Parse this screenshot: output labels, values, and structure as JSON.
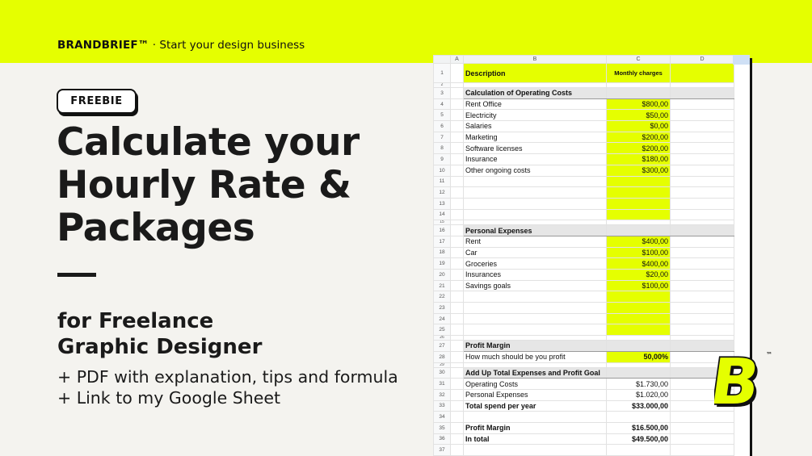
{
  "header": {
    "brand": "BRANDBRIEF™",
    "tagline": "· Start your design business"
  },
  "badge": "FREEBIE",
  "headline": [
    "Calculate your",
    "Hourly Rate &",
    "Packages"
  ],
  "subtitle": [
    "for Freelance",
    "Graphic Designer"
  ],
  "extras": [
    "+ PDF with explanation, tips and formula",
    "+ Link to my Google Sheet"
  ],
  "logo": {
    "letter": "B",
    "mark": "™"
  },
  "colors": {
    "accent": "#e5ff00",
    "ink": "#111111",
    "background": "#f4f3ef"
  },
  "sheet": {
    "columns": [
      "A",
      "B",
      "C",
      "D"
    ],
    "header_row": {
      "num": "1",
      "description": "Description",
      "monthly": "Monthly charges"
    },
    "operating": {
      "title_num": "3",
      "title": "Calculation of Operating Costs",
      "rows": [
        {
          "num": "4",
          "label": "Rent Office",
          "value": "$800,00"
        },
        {
          "num": "5",
          "label": "Electricity",
          "value": "$50,00"
        },
        {
          "num": "6",
          "label": "Salaries",
          "value": "$0,00"
        },
        {
          "num": "7",
          "label": "Marketing",
          "value": "$200,00"
        },
        {
          "num": "8",
          "label": "Software licenses",
          "value": "$200,00"
        },
        {
          "num": "9",
          "label": "Insurance",
          "value": "$180,00"
        },
        {
          "num": "10",
          "label": "Other ongoing costs",
          "value": "$300,00"
        }
      ],
      "empty_rows": [
        "11",
        "12",
        "13",
        "14"
      ]
    },
    "personal": {
      "title_num": "16",
      "title": "Personal Expenses",
      "rows": [
        {
          "num": "17",
          "label": "Rent",
          "value": "$400,00"
        },
        {
          "num": "18",
          "label": "Car",
          "value": "$100,00"
        },
        {
          "num": "19",
          "label": "Groceries",
          "value": "$400,00"
        },
        {
          "num": "20",
          "label": "Insurances",
          "value": "$20,00"
        },
        {
          "num": "21",
          "label": "Savings goals",
          "value": "$100,00"
        }
      ],
      "empty_rows": [
        "22",
        "23",
        "24",
        "25"
      ]
    },
    "profit": {
      "title_num": "27",
      "title": "Profit Margin",
      "row_num": "28",
      "label": "How much should be you profit",
      "value": "50,00%"
    },
    "totals": {
      "title_num": "30",
      "title": "Add Up Total Expenses and Profit Goal",
      "rows": [
        {
          "num": "31",
          "label": "Operating Costs",
          "value": "$1.730,00"
        },
        {
          "num": "32",
          "label": "Personal Expenses",
          "value": "$1.020,00"
        }
      ],
      "total_num": "33",
      "total_label": "Total spend per year",
      "total_value": "$33.000,00"
    },
    "summary": {
      "rows": [
        {
          "num": "35",
          "label": "Profit Margin",
          "value": "$16.500,00"
        },
        {
          "num": "36",
          "label": "In total",
          "value": "$49.500,00"
        }
      ]
    },
    "spacer_rows": {
      "r2": "2",
      "r15": "15",
      "r26": "26",
      "r29": "29",
      "r34": "34",
      "r37": "37"
    }
  }
}
